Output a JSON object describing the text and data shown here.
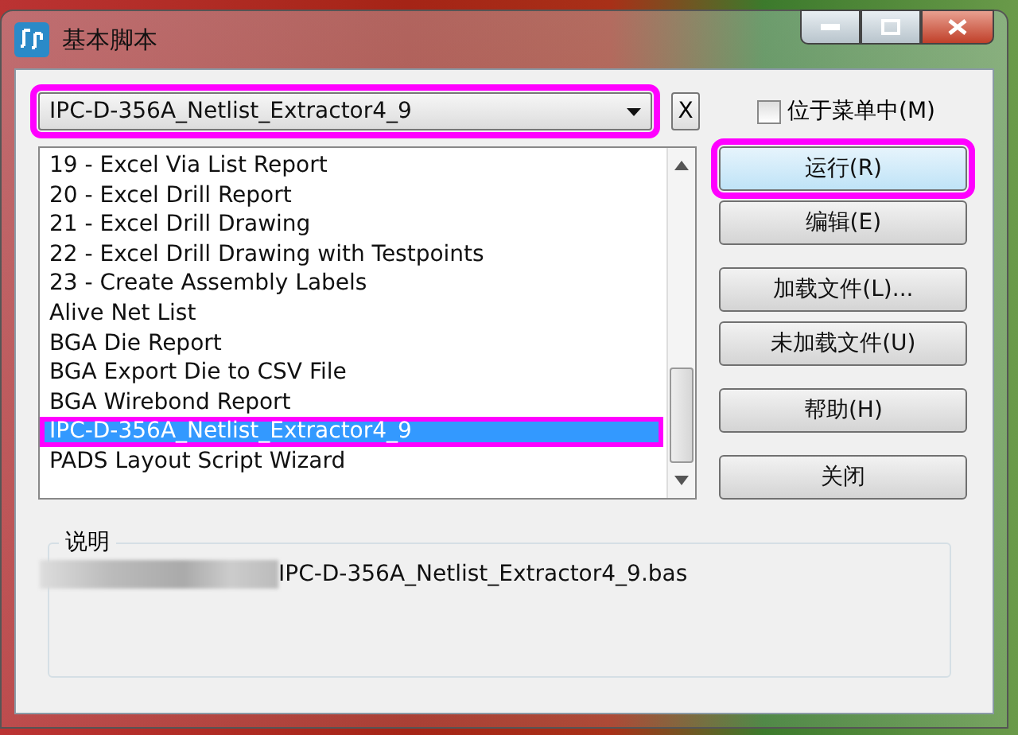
{
  "window": {
    "title": "基本脚本"
  },
  "script_select": {
    "value": "IPC-D-356A_Netlist_Extractor4_9",
    "highlighted": true,
    "clear_button": "X"
  },
  "menu_checkbox": {
    "label": "位于菜单中(M)",
    "checked": false
  },
  "script_list": [
    {
      "label": "19 - Excel Via List Report",
      "selected": false
    },
    {
      "label": "20 - Excel Drill Report",
      "selected": false
    },
    {
      "label": "21 - Excel Drill Drawing",
      "selected": false
    },
    {
      "label": "22 - Excel Drill Drawing with Testpoints",
      "selected": false
    },
    {
      "label": "23 - Create Assembly Labels",
      "selected": false
    },
    {
      "label": "Alive Net List",
      "selected": false
    },
    {
      "label": "BGA Die Report",
      "selected": false
    },
    {
      "label": "BGA Export Die to CSV File",
      "selected": false
    },
    {
      "label": "BGA Wirebond Report",
      "selected": false
    },
    {
      "label": "IPC-D-356A_Netlist_Extractor4_9",
      "selected": true
    },
    {
      "label": "PADS Layout Script Wizard",
      "selected": false
    }
  ],
  "button_groups": [
    [
      {
        "label": "运行(R)",
        "highlighted": true
      },
      {
        "label": "编辑(E)",
        "highlighted": false
      }
    ],
    [
      {
        "label": "加载文件(L)...",
        "highlighted": false
      },
      {
        "label": "未加载文件(U)",
        "highlighted": false
      }
    ],
    [
      {
        "label": "帮助(H)",
        "highlighted": false
      }
    ],
    [
      {
        "label": "关闭",
        "highlighted": false
      }
    ]
  ],
  "description": {
    "title": "说明",
    "text": "IPC-D-356A_Netlist_Extractor4_9.bas",
    "redacted_prefix": true
  }
}
